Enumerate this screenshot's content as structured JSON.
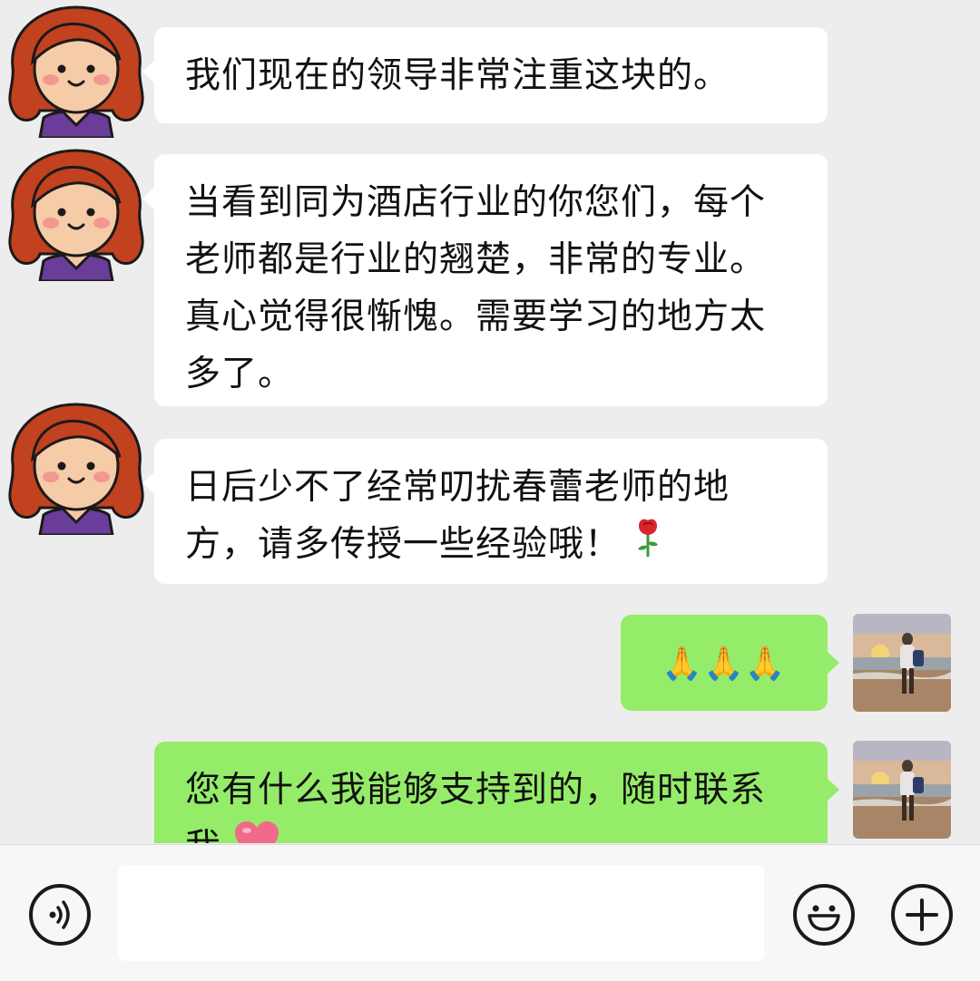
{
  "messages": [
    {
      "side": "left",
      "text": "我们现在的领导非常注重这块的。"
    },
    {
      "side": "left",
      "text": "当看到同为酒店行业的你您们，每个老师都是行业的翘楚，非常的专业。真心觉得很惭愧。需要学习的地方太多了。"
    },
    {
      "side": "left",
      "text": "日后少不了经常叨扰春蕾老师的地方，请多传授一些经验哦！",
      "trailing_emoji": "rose-emoji"
    },
    {
      "side": "right",
      "text": "🙏🙏🙏",
      "emoji_names": [
        "folded-hands-emoji",
        "folded-hands-emoji",
        "folded-hands-emoji"
      ]
    },
    {
      "side": "right",
      "text": "您有什么我能够支持到的，随时联系我",
      "trailing_emoji": "heart-emoji"
    }
  ],
  "input_bar": {
    "voice_icon": "voice-icon",
    "emoji_icon": "smiley-icon",
    "more_icon": "plus-icon",
    "input_value": ""
  },
  "colors": {
    "background": "#ededed",
    "left_bubble": "#ffffff",
    "right_bubble": "#95ec69",
    "avatar_hair": "#c2411f",
    "avatar_shirt": "#6a3d9a"
  }
}
